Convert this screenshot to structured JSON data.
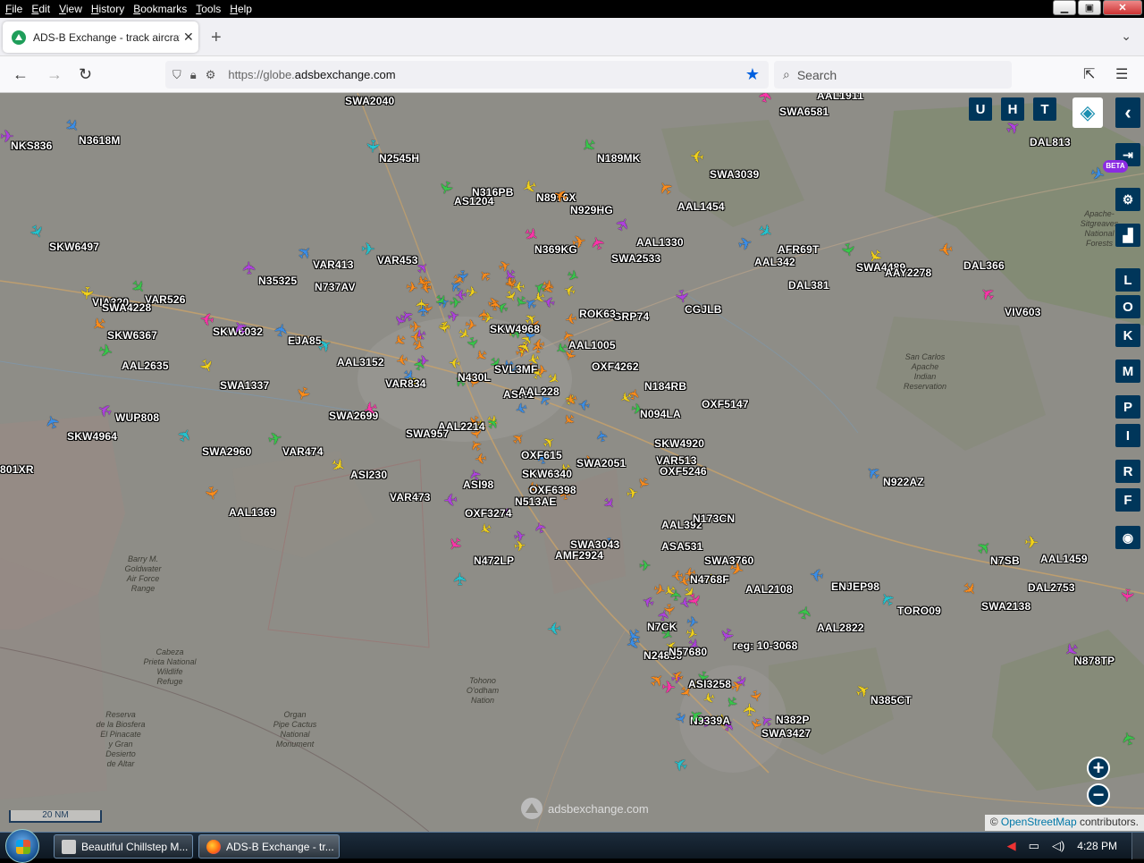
{
  "menu": [
    "File",
    "Edit",
    "View",
    "History",
    "Bookmarks",
    "Tools",
    "Help"
  ],
  "tab": {
    "title": "ADS-B Exchange - track aircraft",
    "close": "✕"
  },
  "nav": {
    "url_prefix": "https://globe.",
    "url_host": "adsbexchange.com",
    "search_placeholder": "Search"
  },
  "map": {
    "controls": [
      "U",
      "H",
      "T"
    ],
    "side_keys": [
      "L",
      "O",
      "K",
      "M",
      "P",
      "I",
      "R",
      "F"
    ],
    "beta": "BETA",
    "scale": "20 NM",
    "watermark": "adsbexchange.com",
    "attribution_symbol": "©",
    "attribution_link": "OpenStreetMap",
    "attribution_text": " contributors."
  },
  "colors": {
    "map_bg": "#8e8d87",
    "orange": "#ff8c1a",
    "yellow": "#f2d21a",
    "purple": "#b040e0",
    "blue": "#3a8ee8",
    "cyan": "#23c4d0",
    "green": "#37c84a",
    "pink": "#ff33aa",
    "control_bg": "#00365a"
  },
  "aircraft_labels": [
    "NKS836",
    "N3618M",
    "SWA2040",
    "N2545H",
    "N189MK",
    "SWA3039",
    "AAL1454",
    "SWA6581",
    "AAL1911",
    "DAL813",
    "SKW6497",
    "AS1204",
    "N316PB",
    "N8976X",
    "N929HG",
    "N369KG",
    "AAL1330",
    "SWA2533",
    "AFR69T",
    "AAL342",
    "SWA4489",
    "AAY2278",
    "DAL366",
    "DAL381",
    "N35325",
    "VAR413",
    "N737AV",
    "VAR453",
    "VAR526",
    "VIA320",
    "SWA4228",
    "SKW6367",
    "SKW6032",
    "EJA85",
    "AAL2635",
    "AAL3152",
    "SWA1337",
    "VIV603",
    "CGJLB",
    "GRP74",
    "ROK63",
    "OXF4262",
    "AAL1005",
    "N184RB",
    "OXF5147",
    "VAR834",
    "N430L",
    "SWA2699",
    "AAL2214",
    "SWA957",
    "WUP808",
    "SKW4964",
    "SWA2960",
    "VAR474",
    "N094LA",
    "SKW4920",
    "VAR513",
    "OXF5246",
    "N922AZ",
    "801XR",
    "ASI230",
    "VAR473",
    "AAL1369",
    "N472LP",
    "OXF3274",
    "AMF2924",
    "SWA3043",
    "AAL392",
    "N173CN",
    "ASA531",
    "SWA3760",
    "N7SB",
    "AAL1459",
    "DAL2753",
    "SWA2138",
    "N4768F",
    "AAL2108",
    "ENJEP98",
    "TORO09",
    "AAL2822",
    "reg: 10-3068",
    "N878TP",
    "N24856",
    "N385CT",
    "N382P",
    "SWA3427",
    "N9339A",
    "ASI3258",
    "SKW4968",
    "OXF6398",
    "SKW6340",
    "SVL3MF",
    "ASI41",
    "OXF615",
    "ASI98",
    "N513AE",
    "SWA2051",
    "AAL228",
    "N57680",
    "N7CK"
  ],
  "taskbar": {
    "items": [
      "Beautiful Chillstep M...",
      "ADS-B Exchange - tr..."
    ],
    "clock": "4:28 PM"
  }
}
